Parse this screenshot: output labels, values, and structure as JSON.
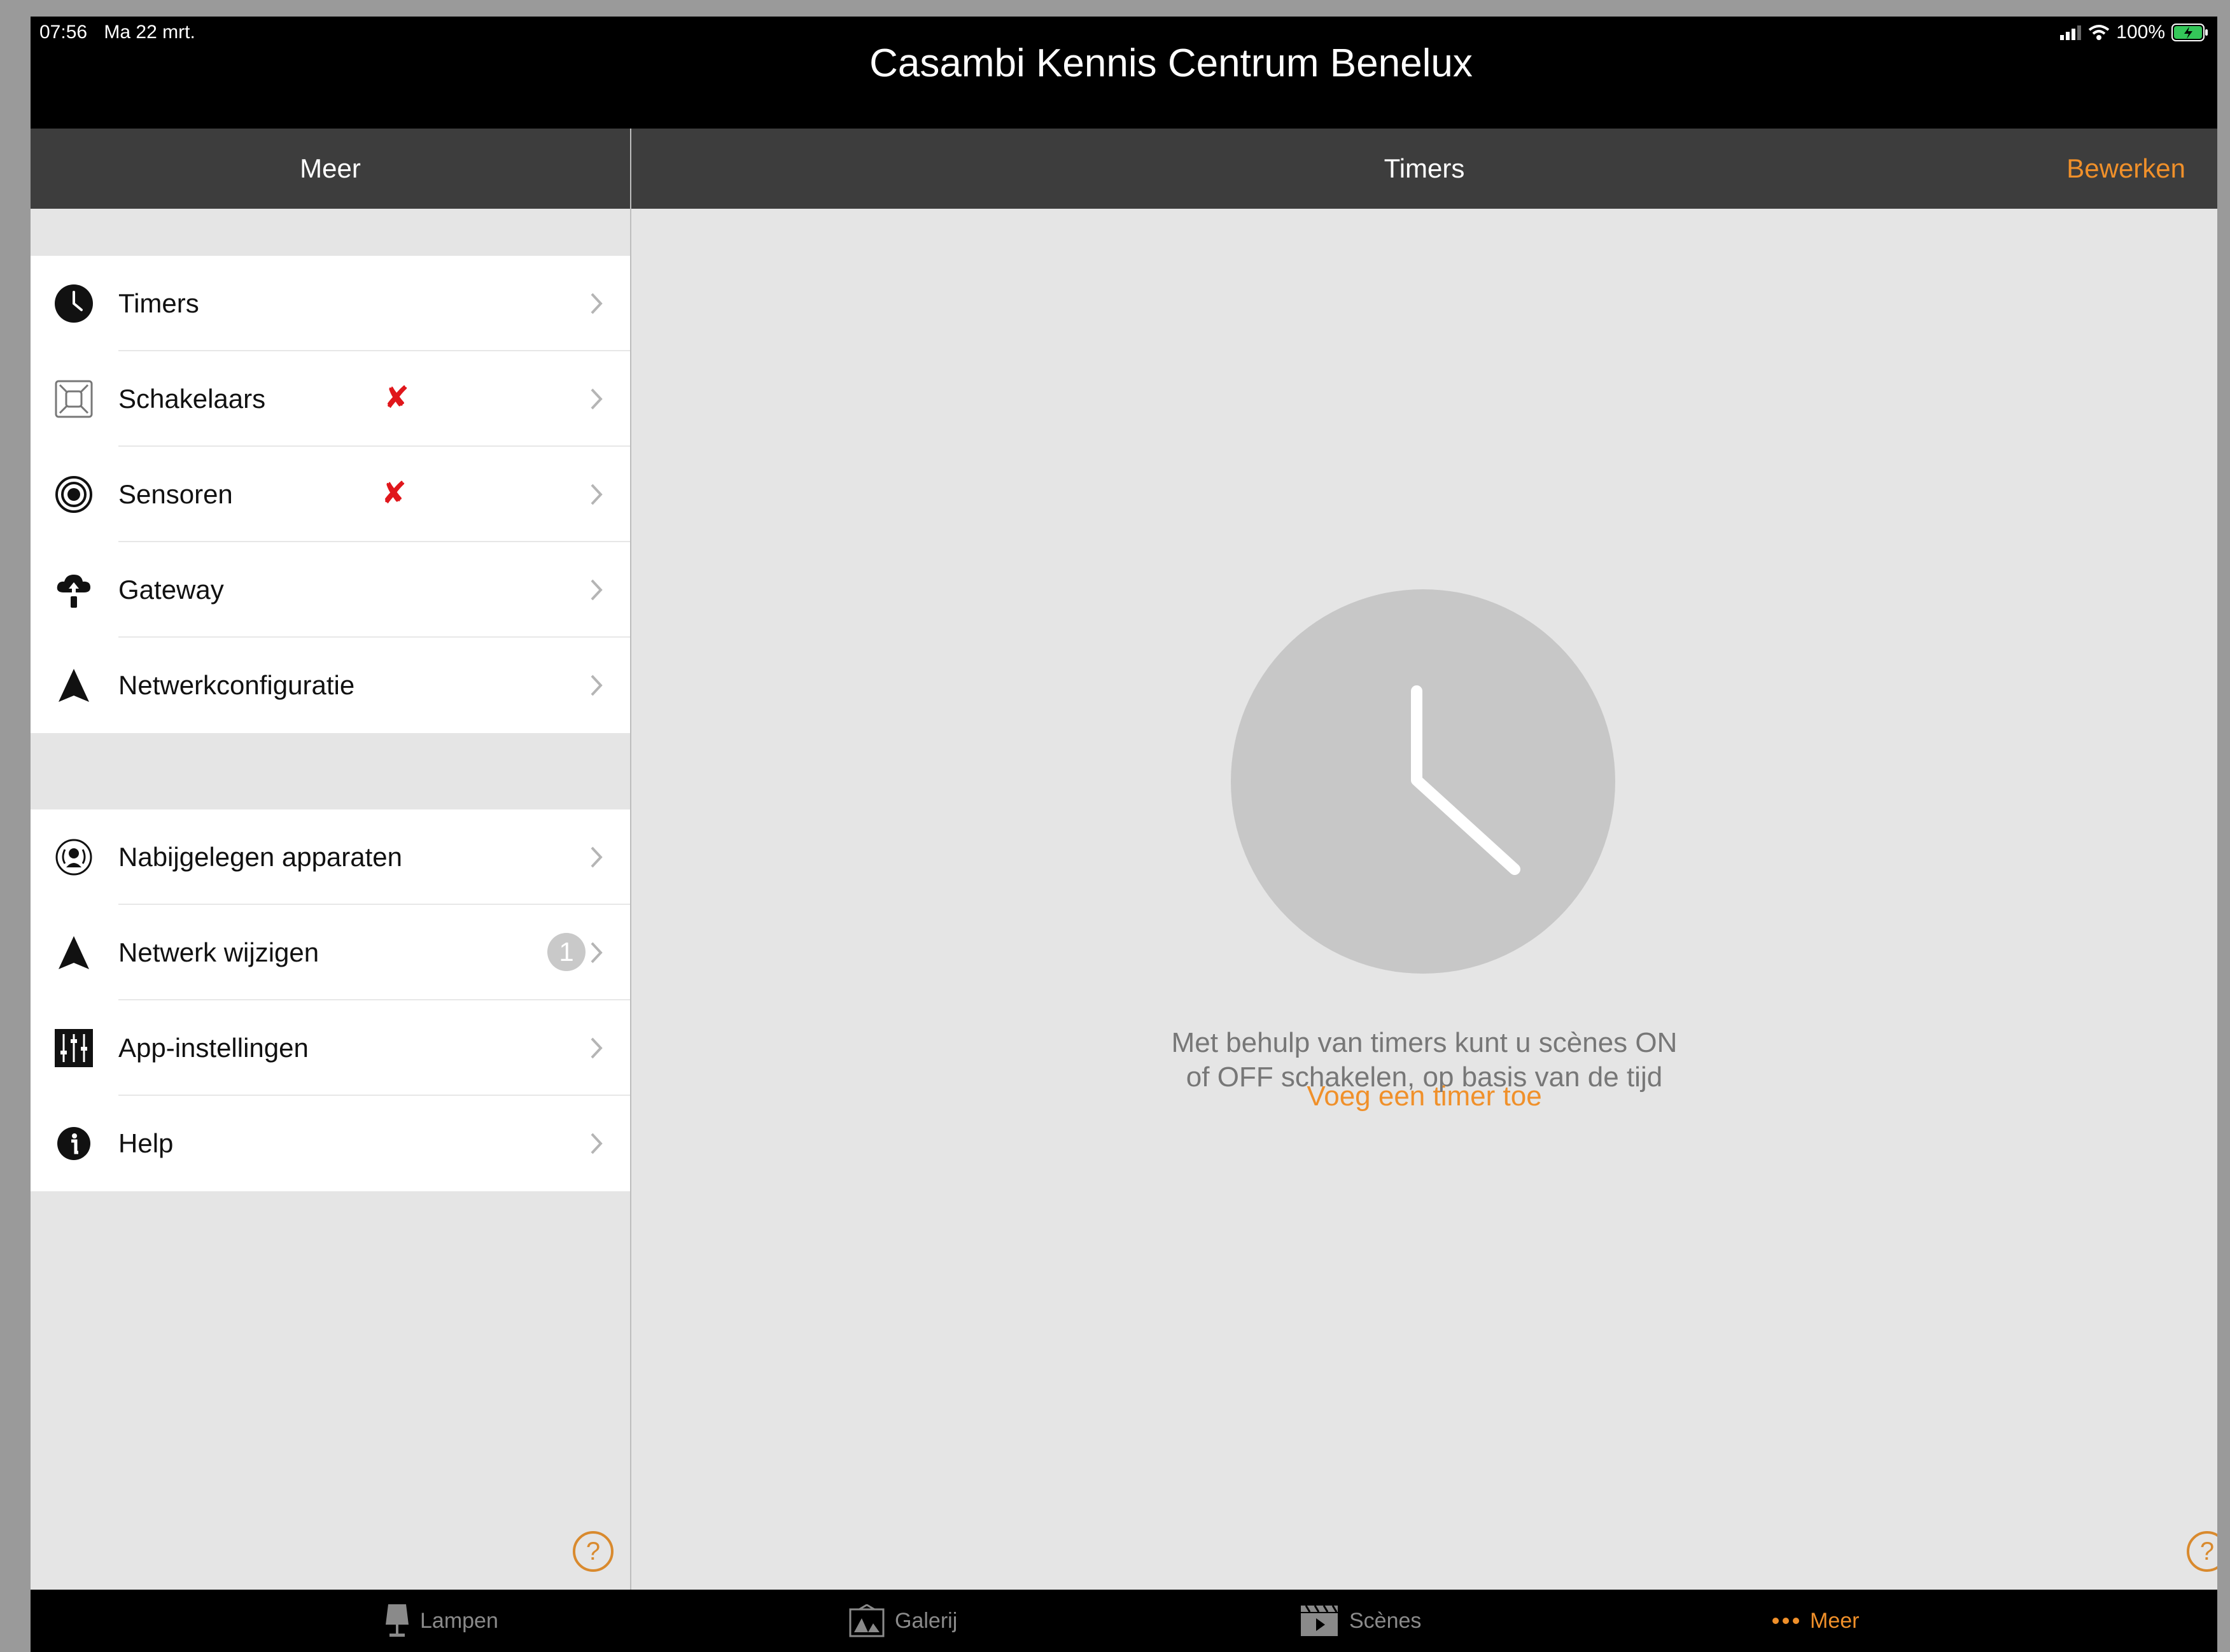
{
  "status_bar": {
    "time": "07:56",
    "date": "Ma 22 mrt.",
    "battery": "100%"
  },
  "app_title": "Casambi Kennis Centrum Benelux",
  "left_header": {
    "title": "Meer"
  },
  "right_header": {
    "title": "Timers",
    "edit_label": "Bewerken"
  },
  "menu_section_1": [
    {
      "label": "Timers",
      "icon": "clock-icon"
    },
    {
      "label": "Schakelaars",
      "icon": "switch-icon",
      "error_mark": "✘"
    },
    {
      "label": "Sensoren",
      "icon": "sensor-icon",
      "error_mark": "✘"
    },
    {
      "label": "Gateway",
      "icon": "cloud-upload-icon"
    },
    {
      "label": "Netwerkconfiguratie",
      "icon": "network-arrow-icon"
    }
  ],
  "menu_section_2": [
    {
      "label": "Nabijgelegen apparaten",
      "icon": "nearby-devices-icon"
    },
    {
      "label": "Netwerk wijzigen",
      "icon": "network-arrow-icon",
      "badge": "1"
    },
    {
      "label": "App-instellingen",
      "icon": "sliders-icon"
    },
    {
      "label": "Help",
      "icon": "info-icon"
    }
  ],
  "help_glyph": "?",
  "empty_state": {
    "message": "Met behulp van timers kunt u scènes ON of OFF schakelen, op basis van de tijd",
    "action": "Voeg een timer toe"
  },
  "tabs": [
    {
      "label": "Lampen",
      "icon": "lamp-icon",
      "active": false
    },
    {
      "label": "Galerij",
      "icon": "gallery-icon",
      "active": false
    },
    {
      "label": "Scènes",
      "icon": "scenes-clapper-icon",
      "active": false
    },
    {
      "label": "Meer",
      "icon": "more-dots-icon",
      "active": true
    }
  ],
  "colors": {
    "accent": "#f0902a",
    "error": "#e0161b",
    "header": "#3d3d3d",
    "panel": "#e5e5e5"
  }
}
